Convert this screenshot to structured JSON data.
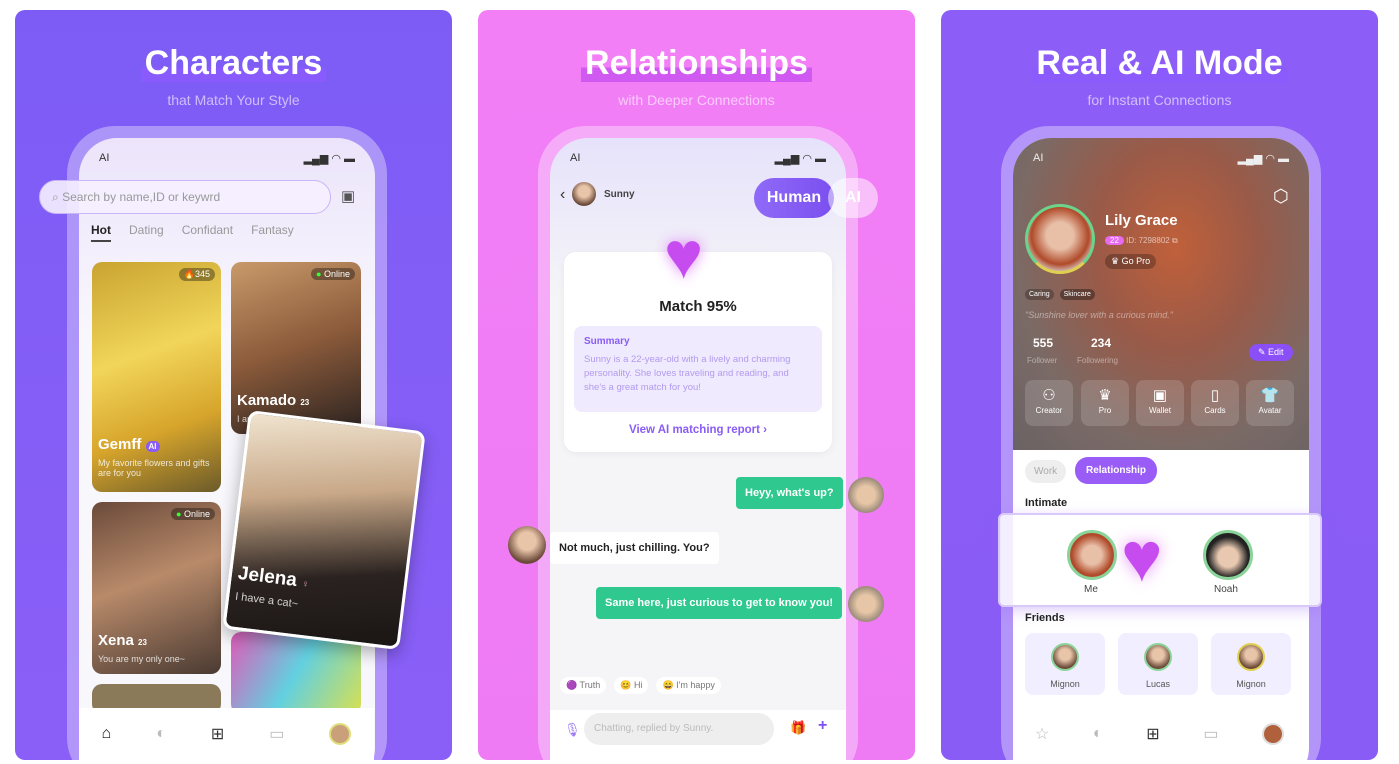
{
  "panels": [
    {
      "title": "Characters",
      "subtitle": "that Match Your Style"
    },
    {
      "title": "Relationships",
      "subtitle": "with Deeper Connections"
    },
    {
      "title": "Real & AI Mode",
      "subtitle": "for Instant Connections"
    }
  ],
  "status": {
    "carrier": "AI",
    "icons": "signal wifi battery"
  },
  "colors": {
    "panel1": "#7d5cf6",
    "panel2": "#f27ff6",
    "panel3": "#8c5ef7",
    "accent": "#7b4ff0",
    "chat_green": "#2fc98f"
  },
  "discover": {
    "search_placeholder": "Search by name,ID or keywrd",
    "tabs": [
      "Hot",
      "Dating",
      "Confidant",
      "Fantasy"
    ],
    "active_tab": "Hot",
    "cards": [
      {
        "name": "Gemff",
        "tag": "AI",
        "desc": "My favorite flowers and gifts are for you",
        "badge": "345"
      },
      {
        "name": "Kamado",
        "tag": "23",
        "desc": "I am ...",
        "badge": "Online"
      },
      {
        "name": "Xena",
        "tag": "23",
        "desc": "You are my only one~",
        "badge": "Online"
      },
      {
        "name": "Jelena",
        "tag": "",
        "desc": "I have a cat~"
      }
    ]
  },
  "chat": {
    "contact": "Sunny",
    "mode_human": "Human",
    "mode_ai": "AI",
    "match": "Match 95%",
    "summary_title": "Summary",
    "summary": "Sunny is a 22-year-old with a lively and charming personality. She loves traveling and reading, and she's a great match for you!",
    "report_link": "View AI matching report",
    "messages": [
      {
        "from": "me",
        "text": "Heyy, what's up?"
      },
      {
        "from": "them",
        "text": "Not much, just chilling. You?"
      },
      {
        "from": "me",
        "text": "Same here, just curious to get to know you!"
      }
    ],
    "quick_replies": [
      "Truth",
      "Hi",
      "I'm happy"
    ],
    "input_placeholder": "Chatting, replied by Sunny."
  },
  "profile": {
    "name": "Lily Grace",
    "age": "22",
    "id": "ID: 7298802",
    "go_pro": "Go Pro",
    "tags": [
      "Caring",
      "Skincare"
    ],
    "bio": "\"Sunshine lover with a curious mind.\"",
    "followers": "555",
    "followers_label": "Follower",
    "following": "234",
    "following_label": "Followering",
    "edit": "Edit",
    "tiles": [
      "Creator",
      "Pro",
      "Wallet",
      "Cards",
      "Avatar"
    ],
    "rel_tabs": [
      "Work",
      "Relationship"
    ],
    "intimate_label": "Intimate",
    "intimate": [
      "Me",
      "Noah"
    ],
    "friends_label": "Friends",
    "friends": [
      "Mignon",
      "Lucas",
      "Mignon"
    ]
  }
}
